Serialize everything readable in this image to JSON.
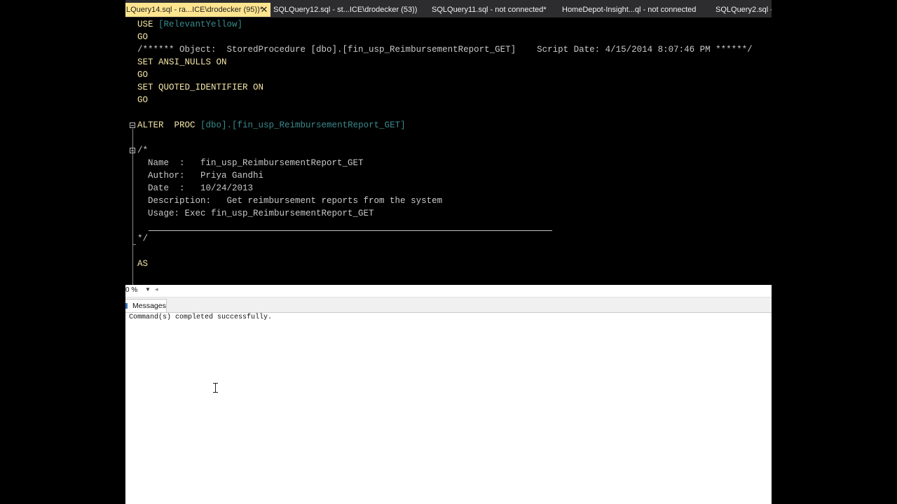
{
  "tabs": [
    {
      "label": "LQuery14.sql - ra...ICE\\drodecker (95))*",
      "active": true,
      "close": "✕"
    },
    {
      "label": "SQLQuery12.sql - st...ICE\\drodecker (53))*"
    },
    {
      "label": "SQLQuery11.sql - not connected*"
    },
    {
      "label": "HomeDepot-Insight...ql - not connected"
    },
    {
      "label": "SQLQuery2.sql -"
    }
  ],
  "editor": {
    "l1": {
      "kw": "USE",
      "br": "[RelevantYellow]"
    },
    "l2": "GO",
    "l3": "/****** Object:  StoredProcedure [dbo].[fin_usp_ReimbursementReport_GET]    Script Date: 4/15/2014 8:07:46 PM ******/",
    "l4": "SET ANSI_NULLS ON",
    "l5": "GO",
    "l6": "SET QUOTED_IDENTIFIER ON",
    "l7": "GO",
    "l9": {
      "kw": "ALTER  PROC",
      "br": "[dbo].[fin_usp_ReimbursementReport_GET]"
    },
    "l11": "/*",
    "l12": "  Name  :   fin_usp_ReimbursementReport_GET",
    "l13": "  Author:   Priya Gandhi",
    "l14": "  Date  :   10/24/2013",
    "l15": "  Description:   Get reimbursement reports from the system",
    "l16": "  Usage: Exec fin_usp_ReimbursementReport_GET",
    "l18": "*/",
    "l20": "AS"
  },
  "zoom": {
    "label": "0 %",
    "arrow": "▼",
    "scroll": "◂"
  },
  "results": {
    "tab_label": "Messages",
    "message": "Command(s) completed successfully."
  },
  "colors": {
    "keyword": "#f5e6a8",
    "bracket_ident": "#3a8a8c",
    "active_tab": "#ffe58f"
  }
}
